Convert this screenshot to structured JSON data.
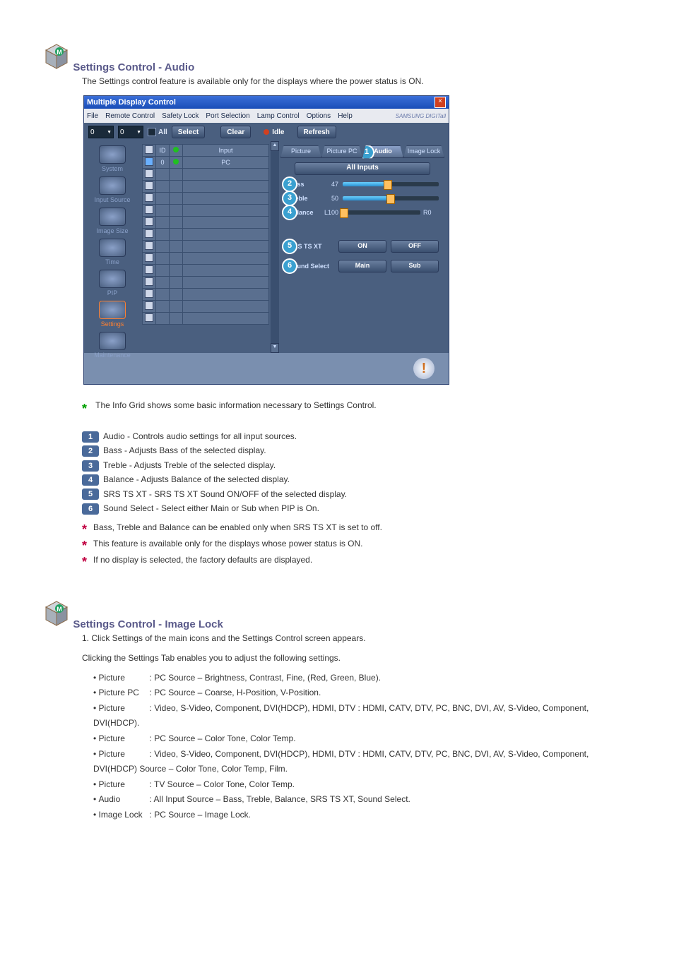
{
  "section1": {
    "title": "Settings Control - Audio",
    "lead": "The Settings control feature is available only for the displays where the power status is ON."
  },
  "section2": {
    "title": "Settings Control - Image Lock",
    "lead": "1. Click Settings of the main icons and the Settings Control screen appears."
  },
  "window": {
    "title": "Multiple Display Control",
    "menus": [
      "File",
      "Remote Control",
      "Safety Lock",
      "Port Selection",
      "Lamp Control",
      "Options",
      "Help"
    ],
    "logo": "SAMSUNG DIGITall",
    "toolbar": {
      "spin1": "0",
      "spin2": "0",
      "all": "All",
      "select": "Select",
      "clear": "Clear",
      "idle": "Idle",
      "refresh": "Refresh"
    },
    "sidebar": [
      "System",
      "Input Source",
      "Image Size",
      "Time",
      "PIP",
      "Settings",
      "Maintenance"
    ],
    "sidebar_active": "Settings",
    "table": {
      "headers": [
        "",
        "ID",
        "",
        "Input"
      ],
      "row0_id": "0",
      "row0_input": "PC"
    },
    "tabs": [
      "Picture",
      "Picture PC",
      "Audio",
      "Image Lock"
    ],
    "tabs_active": "Audio",
    "all_inputs": "All Inputs",
    "sliders": {
      "bass": {
        "label": "Bass",
        "value": "47"
      },
      "treble": {
        "label": "Treble",
        "value": "50"
      },
      "balance": {
        "label": "Balance",
        "left": "L100",
        "right": "R0"
      }
    },
    "toggles": {
      "srs": {
        "label": "SRS TS XT",
        "opt1": "ON",
        "opt2": "OFF"
      },
      "sound": {
        "label": "Sound Select",
        "opt1": "Main",
        "opt2": "Sub"
      }
    }
  },
  "info": {
    "lead": "The Info Grid shows some basic information necessary to Settings Control.",
    "items": [
      {
        "n": "1",
        "txt": "Audio - Controls audio settings for all input sources."
      },
      {
        "n": "2",
        "txt": "Bass - Adjusts Bass of the selected display."
      },
      {
        "n": "3",
        "txt": "Treble - Adjusts Treble of the selected display."
      },
      {
        "n": "4",
        "txt": "Balance - Adjusts Balance of the selected display."
      },
      {
        "n": "5",
        "txt": "SRS TS XT - SRS TS XT Sound ON/OFF of the selected display."
      },
      {
        "n": "6",
        "txt": "Sound Select - Select either Main or Sub when PIP is On."
      }
    ]
  },
  "notes": [
    "Bass, Treble and Balance can be enabled only when SRS TS XT is set to off.",
    "This feature is available only for the displays whose power status is ON.",
    "If no display is selected, the factory defaults are displayed."
  ],
  "bullets_lead": "Clicking the Settings Tab enables you to adjust the following settings.",
  "bullets": [
    {
      "k": "Picture",
      "v": ": PC Source – Brightness, Contrast, Fine, (Red, Green, Blue)."
    },
    {
      "k": "Picture PC",
      "v": ": PC Source – Coarse, H-Position, V-Position."
    },
    {
      "k": "Picture",
      "v": ": Video, S-Video, Component, DVI(HDCP), HDMI, DTV : HDMI, CATV, DTV, PC, BNC, DVI, AV, S-Video, Component, DVI(HDCP)."
    },
    {
      "k": "Picture",
      "v": ": PC Source – Color Tone, Color Temp."
    },
    {
      "k": "Picture",
      "v": ": Video, S-Video, Component, DVI(HDCP), HDMI, DTV : HDMI, CATV, DTV, PC, BNC, DVI, AV, S-Video, Component, DVI(HDCP) Source – Color Tone, Color Temp, Film."
    },
    {
      "k": "Picture",
      "v": ": TV Source – Color Tone, Color Temp."
    },
    {
      "k": "Audio",
      "v": ": All Input Source – Bass, Treble, Balance, SRS TS XT, Sound Select."
    },
    {
      "k": "Image Lock",
      "v": ": PC Source – Image Lock."
    }
  ]
}
